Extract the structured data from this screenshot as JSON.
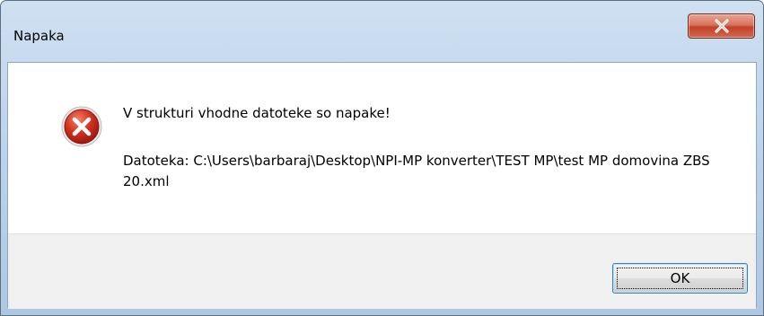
{
  "window": {
    "title": "Napaka"
  },
  "message": {
    "main": "V strukturi vhodne datoteke so napake!",
    "detail": "Datoteka: C:\\Users\\barbaraj\\Desktop\\NPI-MP konverter\\TEST MP\\test MP domovina ZBS 20.xml"
  },
  "buttons": {
    "ok_label": "OK"
  },
  "icons": {
    "status": "error-icon",
    "close": "close-icon"
  },
  "colors": {
    "close_button": "#c2412a",
    "error_icon": "#c8201a"
  }
}
